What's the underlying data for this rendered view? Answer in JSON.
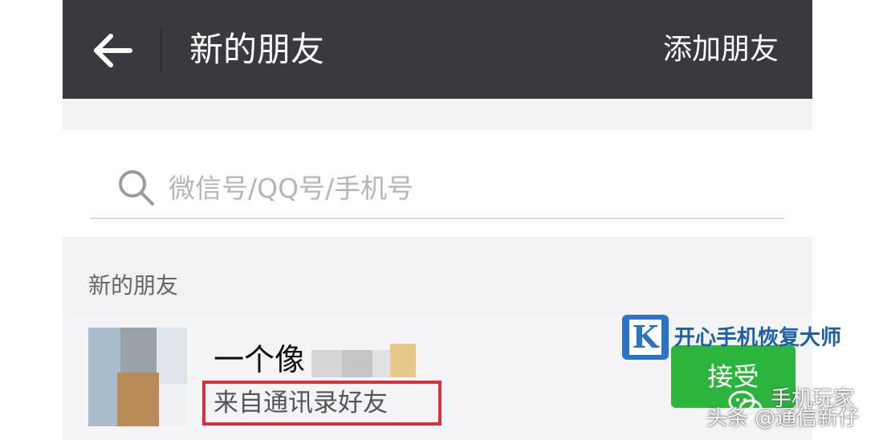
{
  "header": {
    "back_icon": "back-arrow-icon",
    "title": "新的朋友",
    "add_friend_label": "添加朋友"
  },
  "search": {
    "icon": "search-icon",
    "placeholder": "微信号/QQ号/手机号",
    "value": ""
  },
  "section": {
    "label": "新的朋友"
  },
  "friend_request": {
    "name": "一个像",
    "name_obscured": true,
    "source": "来自通讯录好友",
    "accept_label": "接受",
    "accept_color": "#2bb53c"
  },
  "overlay": {
    "brand_letter": "K",
    "brand_name": "开心手机恢复大师",
    "watermark_account": "手机玩家",
    "watermark_source": "头条 @通信新仔"
  },
  "colors": {
    "header_bg": "#393a3f",
    "highlight_border": "#d8303a",
    "brand_blue": "#2b73c7"
  }
}
